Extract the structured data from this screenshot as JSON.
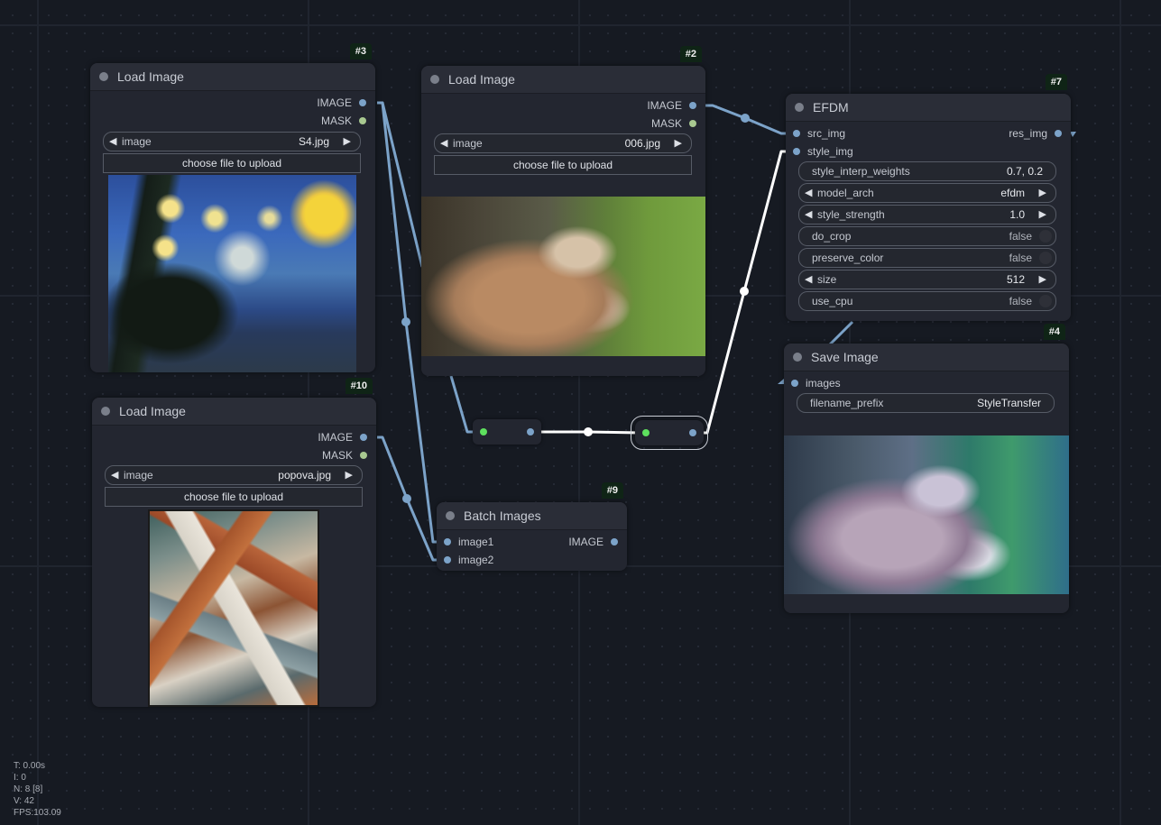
{
  "nodes": {
    "load_image_3": {
      "id_badge": "#3",
      "title": "Load Image",
      "outputs": [
        "IMAGE",
        "MASK"
      ],
      "image_widget": {
        "label": "image",
        "value": "S4.jpg"
      },
      "upload_label": "choose file to upload",
      "preview": "starry-night-painting"
    },
    "load_image_2": {
      "id_badge": "#2",
      "title": "Load Image",
      "outputs": [
        "IMAGE",
        "MASK"
      ],
      "image_widget": {
        "label": "image",
        "value": "006.jpg"
      },
      "upload_label": "choose file to upload",
      "preview": "lynx-photo"
    },
    "load_image_10": {
      "id_badge": "#10",
      "title": "Load Image",
      "outputs": [
        "IMAGE",
        "MASK"
      ],
      "image_widget": {
        "label": "image",
        "value": "popova.jpg"
      },
      "upload_label": "choose file to upload",
      "preview": "cubist-painting"
    },
    "efdm_7": {
      "id_badge": "#7",
      "title": "EFDM",
      "inputs": [
        "src_img",
        "style_img"
      ],
      "outputs": [
        "res_img"
      ],
      "widgets": [
        {
          "type": "text",
          "label": "style_interp_weights",
          "value": "0.7, 0.2"
        },
        {
          "type": "combo",
          "label": "model_arch",
          "value": "efdm"
        },
        {
          "type": "number",
          "label": "style_strength",
          "value": "1.0"
        },
        {
          "type": "toggle",
          "label": "do_crop",
          "value": "false"
        },
        {
          "type": "toggle",
          "label": "preserve_color",
          "value": "false"
        },
        {
          "type": "number",
          "label": "size",
          "value": "512"
        },
        {
          "type": "toggle",
          "label": "use_cpu",
          "value": "false"
        }
      ]
    },
    "save_image_4": {
      "id_badge": "#4",
      "title": "Save Image",
      "inputs": [
        "images"
      ],
      "widgets": [
        {
          "type": "text",
          "label": "filename_prefix",
          "value": "StyleTransfer"
        }
      ],
      "preview": "stylized-lynx"
    },
    "batch_images_9": {
      "id_badge": "#9",
      "title": "Batch Images",
      "inputs": [
        "image1",
        "image2"
      ],
      "outputs": [
        "IMAGE"
      ]
    }
  },
  "colors": {
    "image_slot": "#7ca3c9",
    "mask_slot": "#a8c890",
    "reroute_in": "#5ee05e",
    "active_link": "#ffffff",
    "badge_bg": "#0f2416"
  },
  "stats": {
    "t": "T: 0.00s",
    "i": "I: 0",
    "n": "N: 8 [8]",
    "v": "V: 42",
    "fps": "FPS:103.09"
  }
}
